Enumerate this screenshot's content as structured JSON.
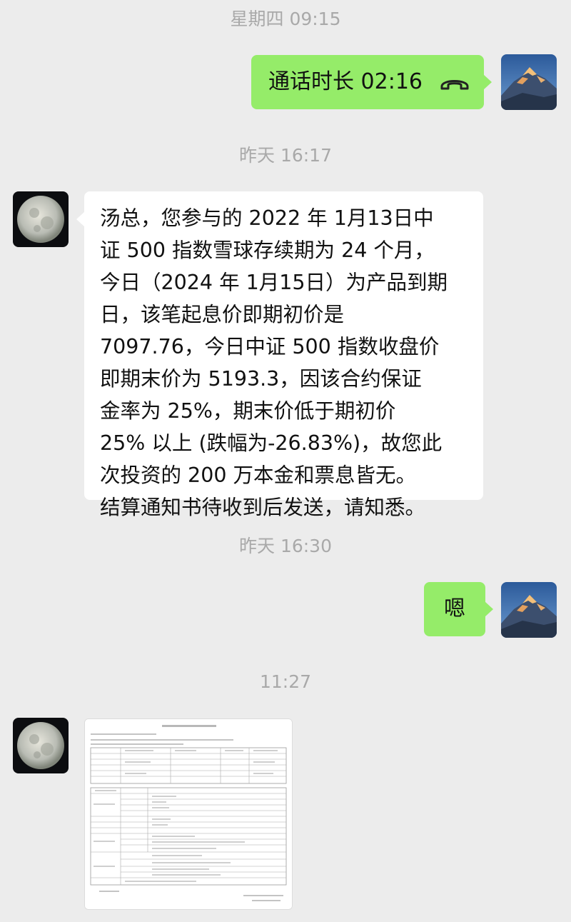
{
  "messages": [
    {
      "timestamp": "星期四 09:15",
      "sender": "me",
      "type": "call",
      "text": "通话时长 02:16",
      "icon": "phone-hangup-icon"
    },
    {
      "timestamp": "昨天 16:17",
      "sender": "other",
      "type": "text",
      "text": "汤总，您参与的 2022 年 1月13日中\n证 500 指数雪球存续期为 24 个月，\n今日（2024 年 1月15日）为产品到期\n日，该笔起息价即期初价是\n7097.76，今日中证 500 指数收盘价\n即期末价为 5193.3，因该合约保证\n金率为 25%，期末价低于期初价\n25% 以上 (跌幅为-26.83%)，故您此\n次投资的 200 万本金和票息皆无。\n结算通知书待收到后发送，请知悉。"
    },
    {
      "timestamp": "昨天 16:30",
      "sender": "me",
      "type": "text",
      "text": "嗯"
    },
    {
      "timestamp": "11:27",
      "sender": "other",
      "type": "image",
      "image": "settlement-notice-document"
    }
  ],
  "colors": {
    "background": "#ececec",
    "my_bubble": "#95ec69",
    "their_bubble": "#ffffff",
    "timestamp": "#a9a9a9"
  },
  "avatars": {
    "me": "mountain-avatar",
    "other": "moon-avatar"
  }
}
